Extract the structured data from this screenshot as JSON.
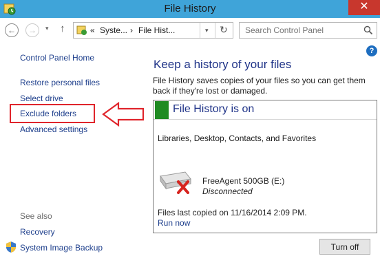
{
  "window": {
    "title": "File History",
    "close_glyph": "✕"
  },
  "navbar": {
    "back_glyph": "←",
    "forward_glyph": "→",
    "dropdown_glyph": "▾",
    "up_glyph": "↑",
    "breadcrumb_overflow": "«",
    "breadcrumb": [
      "Syste...",
      "File Hist..."
    ],
    "crumb_separator": "›",
    "refresh_glyph": "↻",
    "search_placeholder": "Search Control Panel"
  },
  "help_glyph": "?",
  "sidebar": {
    "home": "Control Panel Home",
    "links": [
      "Restore personal files",
      "Select drive",
      "Exclude folders",
      "Advanced settings"
    ],
    "see_also": "See also",
    "see_also_links": [
      "Recovery",
      "System Image Backup"
    ]
  },
  "main": {
    "heading": "Keep a history of your files",
    "description": "File History saves copies of your files so you can get them back if they're lost or damaged.",
    "status": {
      "title": "File History is on",
      "status_color": "#1f8a22",
      "libraries": "Libraries, Desktop, Contacts, and Favorites",
      "drive_name": "FreeAgent 500GB (E:)",
      "drive_status": "Disconnected",
      "last_copied": "Files last copied on 11/16/2014 2:09 PM.",
      "run_now": "Run now"
    },
    "turn_off": "Turn off"
  },
  "colors": {
    "title_bar": "#3fa4d9",
    "close": "#c8372d",
    "link": "#1e3f8c",
    "heading": "#1e3287",
    "annotation": "#e0242b"
  }
}
